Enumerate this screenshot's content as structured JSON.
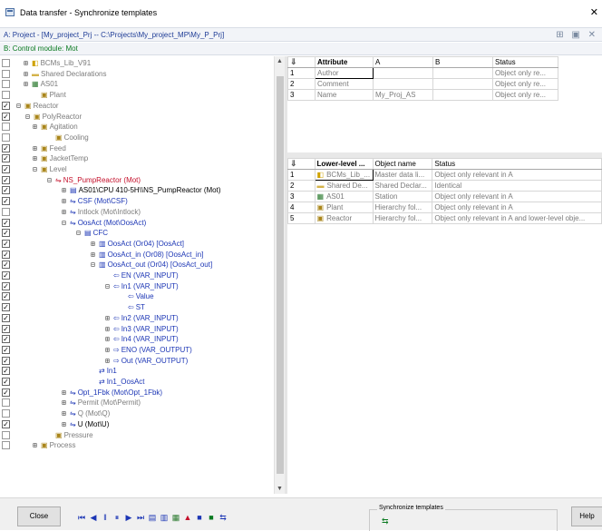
{
  "window": {
    "title": "Data transfer - Synchronize templates",
    "close": "✕"
  },
  "project_bar": {
    "text": "A: Project - [My_project_Prj -- C:\\Projects\\My_project_MP\\My_P_Prj]",
    "tools": "⊞ ▣ ✕"
  },
  "module_bar": {
    "text": "B: Control module: Mot"
  },
  "tree": [
    {
      "label": "BCMs_Lib_V91",
      "exp": "⊞",
      "icon": "◧",
      "style": "grey",
      "check": ""
    },
    {
      "label": "Shared Declarations",
      "exp": "⊞",
      "icon": "▬",
      "style": "grey",
      "check": ""
    },
    {
      "label": "AS01",
      "exp": "⊞",
      "icon": "▦",
      "style": "grey",
      "check": ""
    },
    {
      "label": "Plant",
      "exp": "",
      "icon": "▣",
      "style": "grey",
      "check": ""
    },
    {
      "label": "Reactor",
      "exp": "⊟",
      "icon": "▣",
      "style": "grey",
      "check": "✓"
    },
    {
      "label": "PolyReactor",
      "exp": "⊟",
      "icon": "▣",
      "style": "grey",
      "check": "✓"
    },
    {
      "label": "Agitation",
      "exp": "⊞",
      "icon": "▣",
      "style": "grey",
      "check": ""
    },
    {
      "label": "Cooling",
      "exp": "",
      "icon": "▣",
      "style": "grey",
      "check": ""
    },
    {
      "label": "Feed",
      "exp": "⊞",
      "icon": "▣",
      "style": "grey",
      "check": "✓"
    },
    {
      "label": "JacketTemp",
      "exp": "⊞",
      "icon": "▣",
      "style": "grey",
      "check": "✓"
    },
    {
      "label": "Level",
      "exp": "⊟",
      "icon": "▣",
      "style": "grey",
      "check": "✓"
    },
    {
      "label": "NS_PumpReactor (Mot)",
      "exp": "⊟",
      "icon": "⇋",
      "style": "red",
      "check": "✓"
    },
    {
      "label": "AS01\\CPU 410-5H\\\\NS_PumpReactor (Mot)",
      "exp": "⊞",
      "icon": "▤",
      "style": "dark",
      "check": "✓"
    },
    {
      "label": "CSF (Mot\\CSF)",
      "exp": "⊞",
      "icon": "⇋",
      "style": "blue",
      "check": "✓"
    },
    {
      "label": "Intlock (Mot\\Intlock)",
      "exp": "⊞",
      "icon": "⇋",
      "style": "grey",
      "check": ""
    },
    {
      "label": "OosAct (Mot\\OosAct)",
      "exp": "⊟",
      "icon": "⇋",
      "style": "blue",
      "check": "✓"
    },
    {
      "label": "CFC",
      "exp": "⊟",
      "icon": "▤",
      "style": "blue",
      "check": "✓"
    },
    {
      "label": "OosAct (Or04) [OosAct]",
      "exp": "⊞",
      "icon": "▥",
      "style": "blue",
      "check": "✓"
    },
    {
      "label": "OosAct_in (Or08) [OosAct_in]",
      "exp": "⊞",
      "icon": "▥",
      "style": "blue",
      "check": "✓"
    },
    {
      "label": "OosAct_out (Or04) [OosAct_out]",
      "exp": "⊟",
      "icon": "▥",
      "style": "blue",
      "check": "✓"
    },
    {
      "label": "EN (VAR_INPUT)",
      "exp": "",
      "icon": "⇦",
      "style": "blue",
      "check": "✓"
    },
    {
      "label": "In1 (VAR_INPUT)",
      "exp": "⊟",
      "icon": "⇦",
      "style": "blue",
      "check": "✓"
    },
    {
      "label": "Value",
      "exp": "",
      "icon": "⇦",
      "style": "blue",
      "check": "✓"
    },
    {
      "label": "ST",
      "exp": "",
      "icon": "⇦",
      "style": "blue",
      "check": "✓"
    },
    {
      "label": "In2 (VAR_INPUT)",
      "exp": "⊞",
      "icon": "⇦",
      "style": "blue",
      "check": "✓"
    },
    {
      "label": "In3 (VAR_INPUT)",
      "exp": "⊞",
      "icon": "⇦",
      "style": "blue",
      "check": "✓"
    },
    {
      "label": "In4 (VAR_INPUT)",
      "exp": "⊞",
      "icon": "⇦",
      "style": "blue",
      "check": "✓"
    },
    {
      "label": "ENO (VAR_OUTPUT)",
      "exp": "⊞",
      "icon": "⇨",
      "style": "blue",
      "check": "✓"
    },
    {
      "label": "Out (VAR_OUTPUT)",
      "exp": "⊞",
      "icon": "⇨",
      "style": "blue",
      "check": "✓"
    },
    {
      "label": "In1",
      "exp": "",
      "icon": "⇄",
      "style": "blue",
      "check": "✓"
    },
    {
      "label": "In1_OosAct",
      "exp": "",
      "icon": "⇄",
      "style": "blue",
      "check": "✓"
    },
    {
      "label": "Opt_1Fbk (Mot\\Opt_1Fbk)",
      "exp": "⊞",
      "icon": "⇋",
      "style": "blue",
      "check": "✓"
    },
    {
      "label": "Permit (Mot\\Permit)",
      "exp": "⊞",
      "icon": "⇋",
      "style": "grey",
      "check": ""
    },
    {
      "label": "Q (Mot\\Q)",
      "exp": "⊞",
      "icon": "⇋",
      "style": "grey",
      "check": ""
    },
    {
      "label": "U (Mot\\U)",
      "exp": "⊞",
      "icon": "⇋",
      "style": "dark",
      "check": "✓"
    },
    {
      "label": "Pressure",
      "exp": "",
      "icon": "▣",
      "style": "grey",
      "check": ""
    },
    {
      "label": "Process",
      "exp": "⊞",
      "icon": "▣",
      "style": "grey",
      "check": ""
    }
  ],
  "attr_table": {
    "corner_icon": "⇓",
    "headers": [
      "Attribute",
      "A",
      "B",
      "Status"
    ],
    "rows": [
      {
        "num": "1",
        "attribute": "Author",
        "a": "",
        "b": "",
        "status": "Object only re..."
      },
      {
        "num": "2",
        "attribute": "Comment",
        "a": "",
        "b": "",
        "status": "Object only re..."
      },
      {
        "num": "3",
        "attribute": "Name",
        "a": "My_Proj_AS",
        "b": "",
        "status": "Object only re..."
      }
    ]
  },
  "lower_table": {
    "corner_icon": "⇓",
    "headers": [
      "Lower-level ...",
      "Object name",
      "Status"
    ],
    "rows": [
      {
        "num": "1",
        "icon": "◧",
        "lower": "BCMs_Lib_...",
        "name": "Master data li...",
        "status": "Object only relevant in A"
      },
      {
        "num": "2",
        "icon": "▬",
        "lower": "Shared De...",
        "name": "Shared Declar...",
        "status": "Identical"
      },
      {
        "num": "3",
        "icon": "▦",
        "lower": "AS01",
        "name": "Station",
        "status": "Object only relevant in A"
      },
      {
        "num": "4",
        "icon": "▣",
        "lower": "Plant",
        "name": "Hierarchy fol...",
        "status": "Object only relevant in A"
      },
      {
        "num": "5",
        "icon": "▣",
        "lower": "Reactor",
        "name": "Hierarchy fol...",
        "status": "Object only relevant in A and lower-level obje..."
      }
    ]
  },
  "bottom": {
    "close_label": "Close",
    "help_label": "Help",
    "sync_label": "Synchronize templates",
    "sync_icon": "⇆",
    "nav": [
      "⏮",
      "◀",
      "‖",
      "⏸",
      "▶",
      "⏭",
      "▤",
      "▥",
      "▦",
      "▲",
      "■",
      "■",
      "⇆"
    ]
  }
}
